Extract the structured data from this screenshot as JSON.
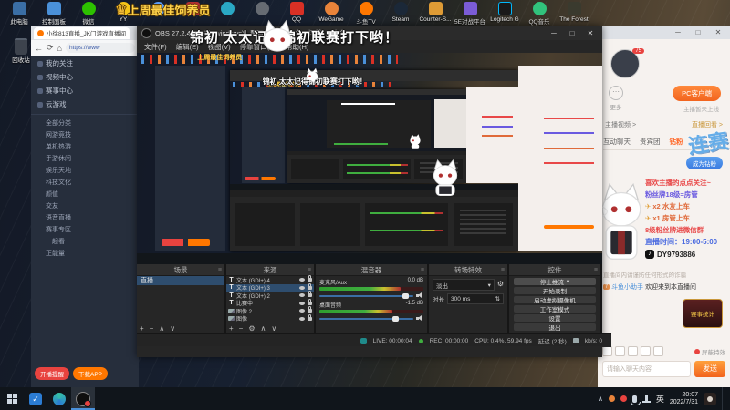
{
  "desktop": {
    "badge": {
      "crown": "♛",
      "text": "上周最佳饲养员"
    },
    "danmaku": "锦初 太太记得锦初联赛打下哟！",
    "recycle_bin": "回收站",
    "icons": [
      {
        "label": "此电脑"
      },
      {
        "label": "控制面板"
      },
      {
        "label": "微信"
      },
      {
        "label": "YY"
      },
      {
        "label": ""
      },
      {
        "label": ""
      },
      {
        "label": ""
      },
      {
        "label": ""
      },
      {
        "label": "QQ"
      },
      {
        "label": "WeGame"
      },
      {
        "label": "斗鱼TV"
      },
      {
        "label": "Steam"
      },
      {
        "label": "Counter-S..."
      },
      {
        "label": "5E对战平台"
      },
      {
        "label": "Logitech G"
      },
      {
        "label": "QQ音乐"
      },
      {
        "label": "The Forest"
      }
    ]
  },
  "browser": {
    "tab_title": "小徐813直播_JK门游戏直播间",
    "url": "https://www",
    "back": "←",
    "refresh": "⟳",
    "home": "⌂",
    "window_buttons": {
      "min": "─",
      "max": "□",
      "close": "✕"
    },
    "sidebar": {
      "items": [
        "我的关注",
        "视频中心",
        "赛事中心",
        "云游戏"
      ],
      "categories": [
        "全部分类",
        "网游竞技",
        "单机热游",
        "手游休闲",
        "娱乐天地",
        "科技文化",
        "颜值",
        "交友",
        "语音直播",
        "赛事专区",
        "一起看",
        "正能量"
      ],
      "buttons": {
        "remind": "开播提醒",
        "download": "下载APP"
      }
    },
    "right": {
      "streamer_badge": "75",
      "more": "更多",
      "more_icon": "⋯",
      "pc_client": "PC客户端",
      "online_hint": "主播暂未上线",
      "video_link": "主播视频 >",
      "replay_link": "直播回看 >",
      "tabs": [
        "互动聊天",
        "贵宾团",
        "钻粉"
      ],
      "join_fans": "成为钻粉",
      "watermark": "连赛",
      "notice": {
        "follow": "喜欢主播的点点关注~",
        "fan18": "粉丝牌18级=房管",
        "plane": "✈",
        "car2": "x2 水友上车",
        "car1": "x1 房管上车",
        "fan8": "8级粉丝牌进微信群"
      },
      "live_time": "直播时间：19:00-5:00",
      "douyin_note": "♪",
      "douyin_id": "DY9793886",
      "sys_hint": "直播间内请谨防任何形式的诈骗",
      "chat": {
        "badge": "7",
        "name": "斗鱼小助手",
        "text": "欢迎来到本直播间"
      },
      "stat_badge": "赛事统计",
      "block_effect": "屏蔽特效",
      "input_placeholder": "请输入聊天内容",
      "send": "发送"
    }
  },
  "obs": {
    "title": "OBS 27.2.4 (64-bit, windows) - 配置文件: 未命名 - 场景: 未命名",
    "window_buttons": {
      "min": "─",
      "max": "□",
      "close": "✕"
    },
    "menu": [
      "文件(F)",
      "编辑(E)",
      "视图(V)",
      "停靠窗口(D)",
      "帮助(H)"
    ],
    "scenes": {
      "header": "场景",
      "items": [
        "直播"
      ],
      "toolbar": {
        "add": "+",
        "remove": "−",
        "up": "∧",
        "down": "∨"
      }
    },
    "sources": {
      "header": "来源",
      "items": [
        {
          "name": "文本 (GDI+) 4"
        },
        {
          "name": "文本 (GDI+) 3"
        },
        {
          "name": "文本 (GDI+) 2"
        },
        {
          "name": "比赛中"
        },
        {
          "name": "图像 2"
        },
        {
          "name": "图像"
        }
      ],
      "toolbar": {
        "add": "+",
        "remove": "−",
        "props": "⚙",
        "up": "∧",
        "down": "∨"
      }
    },
    "mixer": {
      "header": "混音器",
      "channels": [
        {
          "name": "麦克风/Aux",
          "db": "0.0 dB",
          "meter": 0.78,
          "slider": 0.92
        },
        {
          "name": "桌面音频",
          "db": "-1.5 dB",
          "meter": 0.7,
          "slider": 0.82
        }
      ]
    },
    "transitions": {
      "header": "转场特效",
      "type": "淡出",
      "chevron": "▾",
      "gear": "⚙",
      "duration_label": "时长",
      "duration": "300 ms",
      "spin": "⇅"
    },
    "controls": {
      "header": "控件",
      "buttons": [
        "停止推流",
        "开始录制",
        "启动虚拟摄像机",
        "工作室模式",
        "设置",
        "退出"
      ],
      "stream_chevron": "▾"
    },
    "status": {
      "live_label": "LIVE:",
      "live": "00:00:04",
      "rec_label": "REC:",
      "rec": "00:00:00",
      "cpu": "CPU: 0.4%, 59.94 fps",
      "delay": "延迟 (2 秒)",
      "bitrate": "kb/s: 0"
    }
  },
  "taskbar": {
    "tray": {
      "up": "∧",
      "ime": "英",
      "time": "20:07",
      "date": "2022/7/31"
    }
  }
}
